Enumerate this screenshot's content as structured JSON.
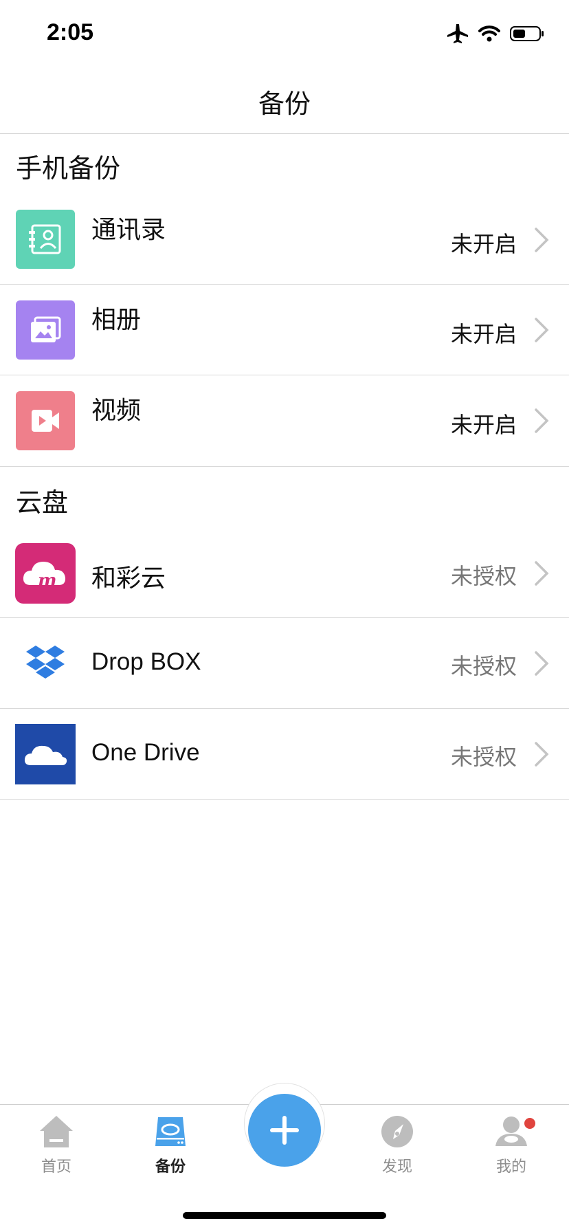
{
  "status_bar": {
    "time": "2:05"
  },
  "nav": {
    "title": "备份"
  },
  "sections": {
    "phone_backup": {
      "title": "手机备份",
      "items": [
        {
          "label": "通讯录",
          "status": "未开启",
          "icon": "contacts-icon",
          "color": "#5fd3b5"
        },
        {
          "label": "相册",
          "status": "未开启",
          "icon": "photo-album-icon",
          "color": "#a583f0"
        },
        {
          "label": "视频",
          "status": "未开启",
          "icon": "video-icon",
          "color": "#ef7f8b"
        }
      ]
    },
    "cloud_disk": {
      "title": "云盘",
      "items": [
        {
          "label": "和彩云",
          "status": "未授权",
          "icon": "hecaiyun-logo-icon",
          "color": "#d42b77"
        },
        {
          "label": "Drop BOX",
          "status": "未授权",
          "icon": "dropbox-logo-icon",
          "color": "#2f7de1"
        },
        {
          "label": "One Drive",
          "status": "未授权",
          "icon": "onedrive-logo-icon",
          "color": "#1f4aa8"
        }
      ]
    }
  },
  "tab_bar": {
    "tabs": [
      {
        "label": "首页",
        "icon": "home-icon",
        "active": false
      },
      {
        "label": "备份",
        "icon": "backup-drive-icon",
        "active": true
      },
      {
        "label": "发现",
        "icon": "compass-icon",
        "active": false
      },
      {
        "label": "我的",
        "icon": "profile-icon",
        "active": false
      }
    ],
    "fab_icon": "plus-icon",
    "accent": "#4aa2ea"
  }
}
